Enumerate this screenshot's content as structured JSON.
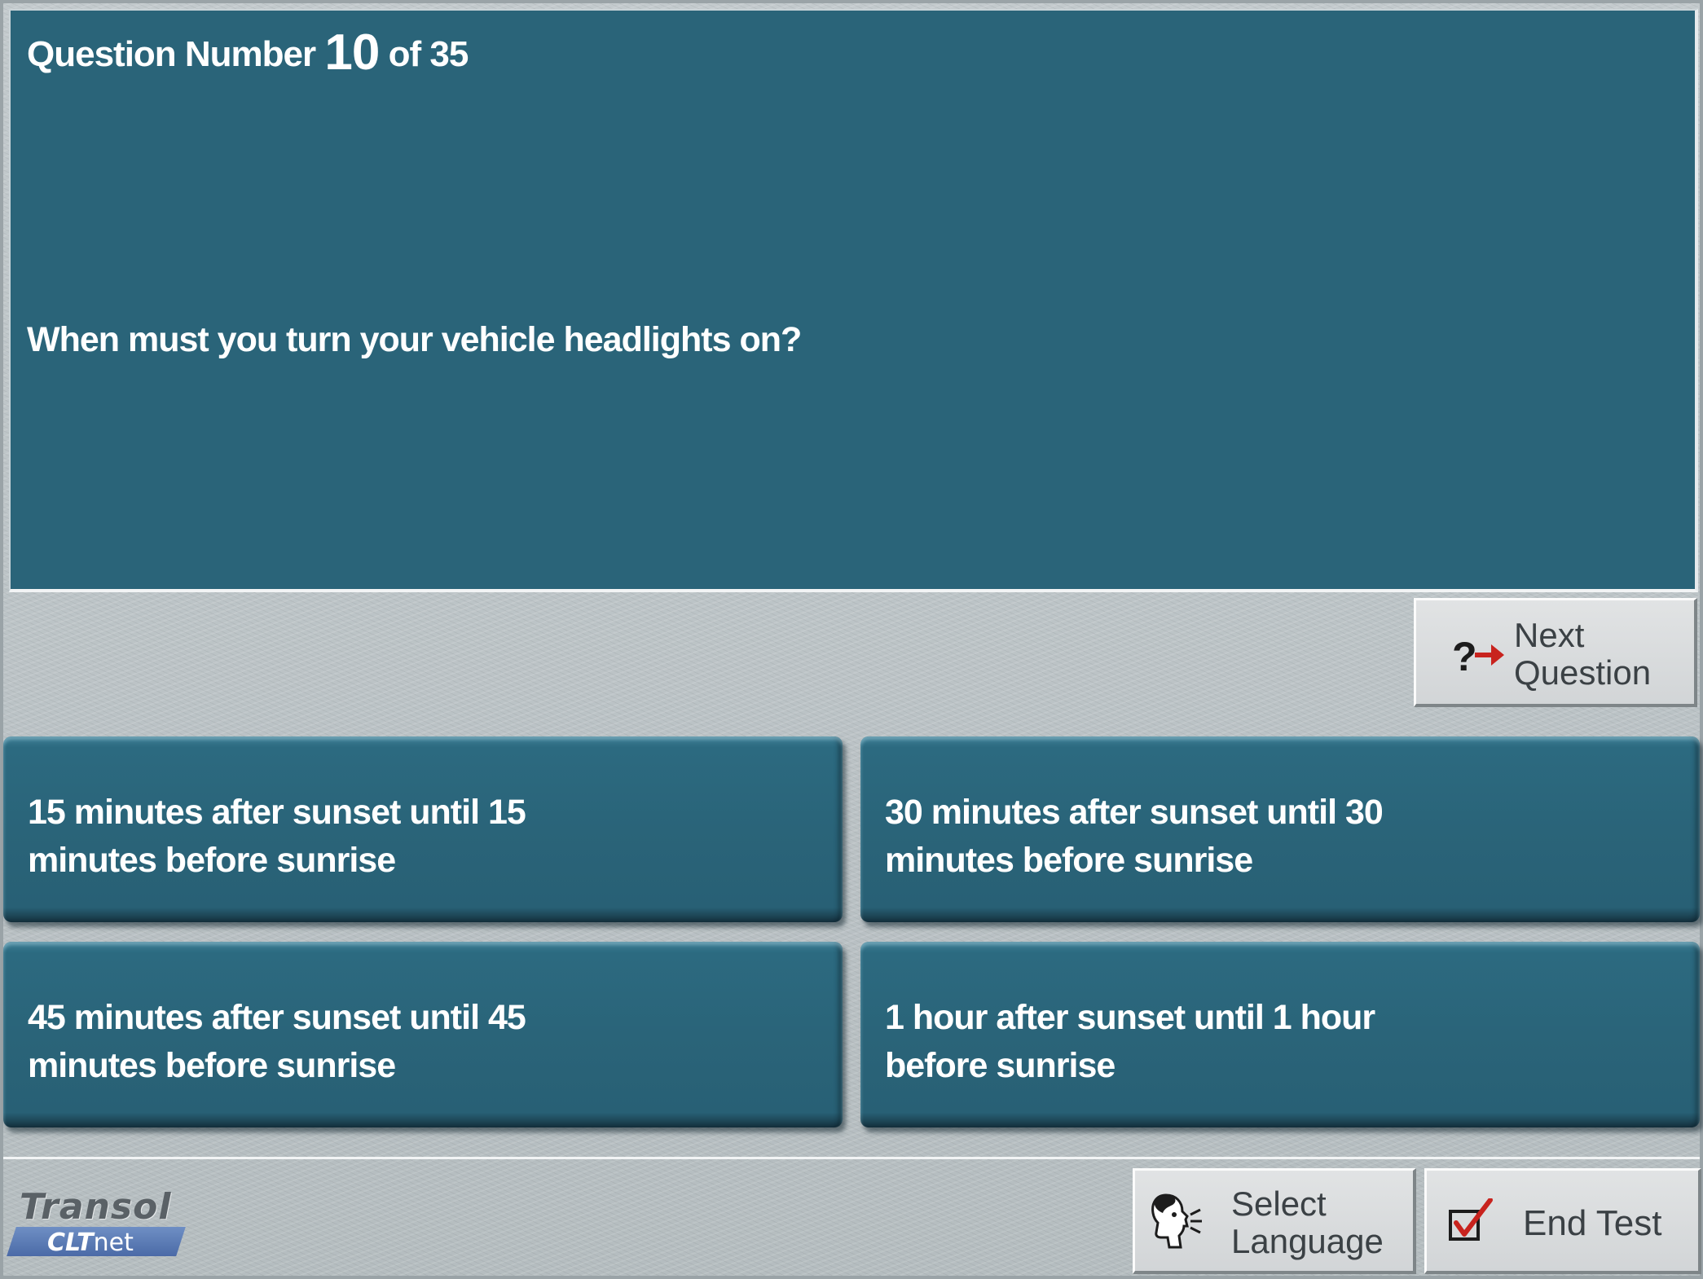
{
  "question": {
    "number_prefix": "Question Number",
    "number": "10",
    "number_suffix": "of 35",
    "text": "When must you turn your vehicle headlights on?"
  },
  "answers": [
    {
      "label": "15 minutes after sunset until 15 minutes before sunrise"
    },
    {
      "label": "30 minutes after sunset until 30 minutes before sunrise"
    },
    {
      "label": "45 minutes after sunset until 45 minutes before sunrise"
    },
    {
      "label": "1 hour after sunset until 1 hour before sunrise"
    }
  ],
  "buttons": {
    "next": {
      "line1": "Next",
      "line2": "Question",
      "icon": "question-arrow-icon"
    },
    "language": {
      "line1": "Select",
      "line2": "Language",
      "icon": "speaking-head-icon"
    },
    "end": {
      "label": "End Test",
      "icon": "checkbox-check-icon"
    }
  },
  "logo": {
    "brand": "Transol",
    "product_bold": "CLT",
    "product_light": "net"
  },
  "colors": {
    "panel": "#2a6479",
    "background": "#b9c1c4",
    "button": "#d9dbdc",
    "icon_red": "#c8231e"
  }
}
